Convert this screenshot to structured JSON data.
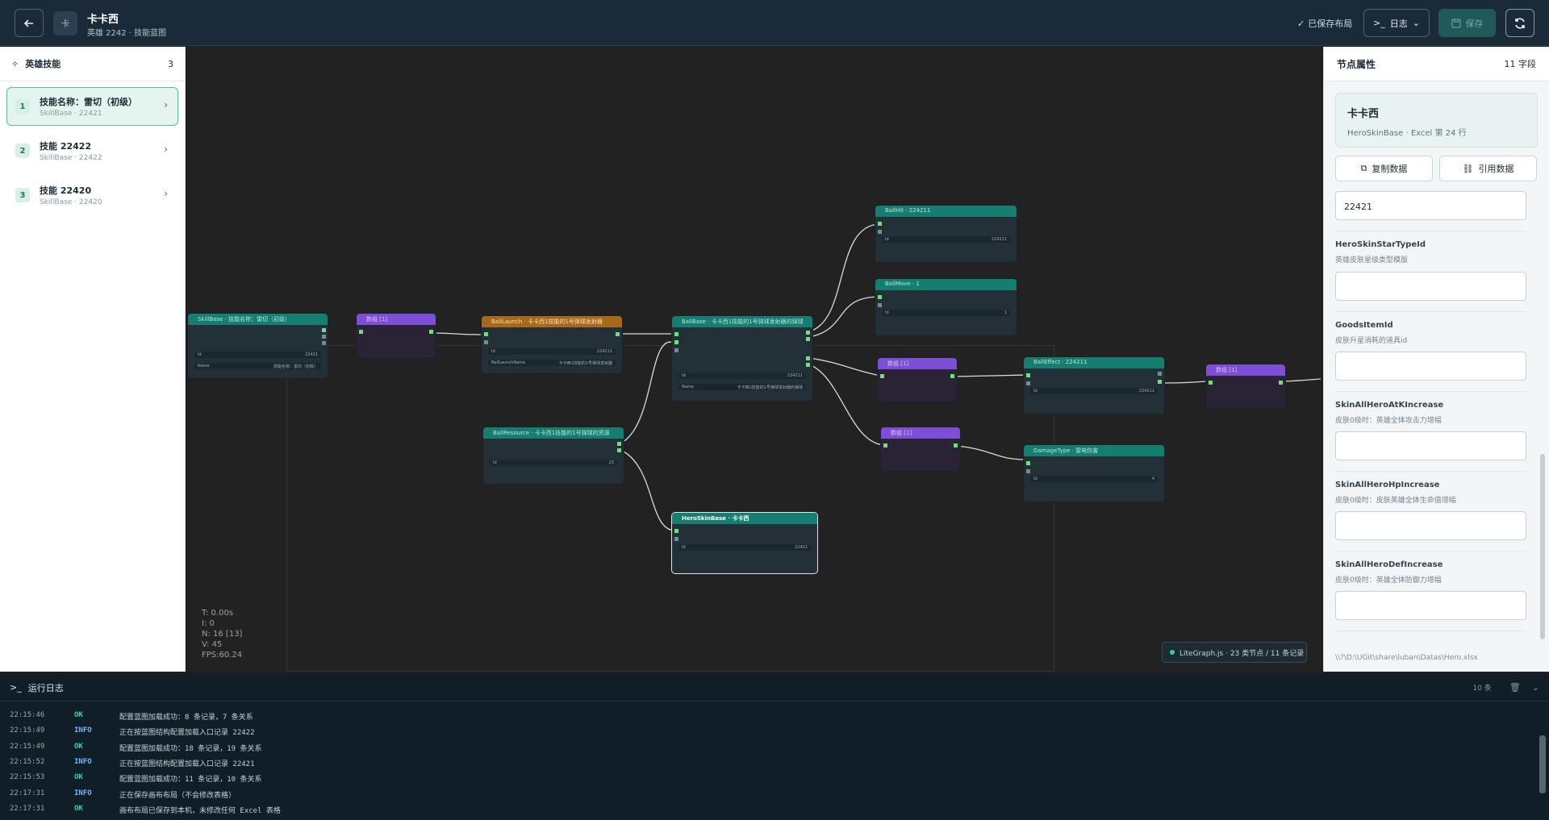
{
  "header": {
    "avatar_text": "卡",
    "title": "卡卡西",
    "subtitle": "英雄 2242 · 技能蓝图",
    "saved_status": "已保存布局",
    "log_button": "日志",
    "save_button": "保存"
  },
  "skills_panel": {
    "title": "英雄技能",
    "count": "3",
    "items": [
      {
        "index": "1",
        "name": "技能名称：雷切（初级）",
        "meta": "SkillBase · 22421"
      },
      {
        "index": "2",
        "name": "技能 22422",
        "meta": "SkillBase · 22422"
      },
      {
        "index": "3",
        "name": "技能 22420",
        "meta": "SkillBase · 22420"
      }
    ]
  },
  "graph": {
    "nodes": {
      "n1": {
        "title": "SkillBase · 技能名称：雷切（初级）",
        "r1k": "Id",
        "r1v": "22421",
        "r2k": "Name",
        "r2v": "技能名称：雷切（初级）"
      },
      "n2": {
        "title": "数组 [1]"
      },
      "n3": {
        "title": "BallLaunch · 卡卡西1技能的1号弹球发射器",
        "r1k": "Id",
        "r1v": "224211",
        "r2k": "BallLaunchName",
        "r2v": "卡卡西1技能的1号弹球发射器"
      },
      "n4": {
        "title": "BallBase · 卡卡西1技能的1号弹球发射器的弹球",
        "r1k": "Id",
        "r1v": "224211",
        "r2k": "Name",
        "r2v": "卡卡西1技能的1号弹球发射器的弹球"
      },
      "n5": {
        "title": "BallResource · 卡卡西1技能的1号弹球的资源",
        "r1k": "Id",
        "r1v": "23"
      },
      "n6": {
        "title": "HeroSkinBase · 卡卡西",
        "r1k": "Id",
        "r1v": "22421"
      },
      "n7": {
        "title": "BallHit · 224211",
        "r1k": "Id",
        "r1v": "224211"
      },
      "n8": {
        "title": "BallMove · 1",
        "r1k": "Id",
        "r1v": "1"
      },
      "n9": {
        "title": "数组 [1]"
      },
      "n10": {
        "title": "数组 [1]"
      },
      "n11": {
        "title": "BallEffect · 224211",
        "r1k": "Id",
        "r1v": "224211"
      },
      "n12": {
        "title": "DamageType · 雷电伤害",
        "r1k": "Id",
        "r1v": "4"
      },
      "n13": {
        "title": "数组 [1]"
      }
    },
    "stats": {
      "t": "T: 0.00s",
      "i": "I: 0",
      "n": "N: 16 [13]",
      "v": "V: 45",
      "fps": "FPS:60.24"
    },
    "badge": "LiteGraph.js · 23 类节点 / 11 条记录"
  },
  "props_panel": {
    "title": "节点属性",
    "count": "11 字段",
    "card_title": "卡卡西",
    "card_sub": "HeroSkinBase · Excel 第 24 行",
    "copy_button": "复制数据",
    "ref_button": "引用数据",
    "first_value": "22421",
    "fields": [
      {
        "name": "HeroSkinStarTypeId",
        "desc": "英雄皮肤星级类型模版",
        "value": ""
      },
      {
        "name": "GoodsItemId",
        "desc": "皮肤升星消耗的道具id",
        "value": ""
      },
      {
        "name": "SkinAllHeroAtKIncrease",
        "desc": "皮肤0级时：英雄全体攻击力增幅",
        "value": ""
      },
      {
        "name": "SkinAllHeroHpIncrease",
        "desc": "皮肤0级时：皮肤英雄全体生命值增幅",
        "value": ""
      },
      {
        "name": "SkinAllHeroDefIncrease",
        "desc": "皮肤0级时：英雄全体防御力增幅",
        "value": ""
      }
    ],
    "path": "\\\\?\\D:\\UGit\\share\\luban\\Datas\\Hero.xlsx"
  },
  "log_panel": {
    "title": "运行日志",
    "count": "10 条",
    "rows": [
      {
        "time": "22:15:46",
        "level": "OK",
        "msg": "配置蓝图加载成功：8 条记录，7 条关系"
      },
      {
        "time": "22:15:49",
        "level": "INFO",
        "msg": "正在按蓝图结构配置加载入口记录 22422"
      },
      {
        "time": "22:15:49",
        "level": "OK",
        "msg": "配置蓝图加载成功：18 条记录，19 条关系"
      },
      {
        "time": "22:15:52",
        "level": "INFO",
        "msg": "正在按蓝图结构配置加载入口记录 22421"
      },
      {
        "time": "22:15:53",
        "level": "OK",
        "msg": "配置蓝图加载成功：11 条记录，10 条关系"
      },
      {
        "time": "22:17:31",
        "level": "INFO",
        "msg": "正在保存画布布局（不会修改表格）"
      },
      {
        "time": "22:17:31",
        "level": "OK",
        "msg": "画布布局已保存到本机，未修改任何 Excel 表格"
      }
    ]
  }
}
